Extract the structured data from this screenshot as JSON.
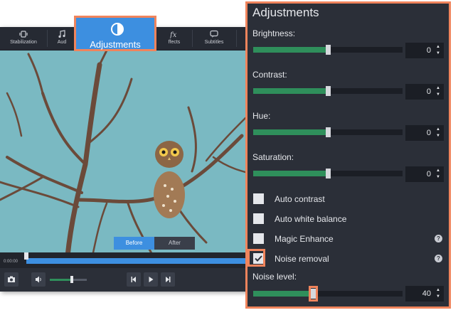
{
  "toolbar": {
    "items": [
      "Stabilization",
      "Aud",
      "ffects",
      "Subtitles"
    ]
  },
  "callout": {
    "label": "Adjustments"
  },
  "preview": {
    "before_label": "Before",
    "after_label": "After"
  },
  "timeline": {
    "time": "0:00:00",
    "progress": 0.0
  },
  "volume": {
    "level": 0.6
  },
  "panel": {
    "title": "Adjustments",
    "sliders": [
      {
        "label": "Brightness:",
        "value": "0",
        "level": 0.5
      },
      {
        "label": "Contrast:",
        "value": "0",
        "level": 0.5
      },
      {
        "label": "Hue:",
        "value": "0",
        "level": 0.5
      },
      {
        "label": "Saturation:",
        "value": "0",
        "level": 0.5
      }
    ],
    "checkboxes": [
      {
        "label": "Auto contrast",
        "checked": false
      },
      {
        "label": "Auto white balance",
        "checked": false
      },
      {
        "label": "Magic Enhance",
        "checked": false
      },
      {
        "label": "Noise removal",
        "checked": true
      }
    ],
    "noise_level": {
      "label": "Noise level:",
      "value": "40",
      "level": 0.4
    }
  },
  "colors": {
    "accent": "#3d8fe0",
    "highlight": "#f0845c",
    "slider_fill": "#2f8f5b",
    "panel_bg": "#2b2f38"
  }
}
